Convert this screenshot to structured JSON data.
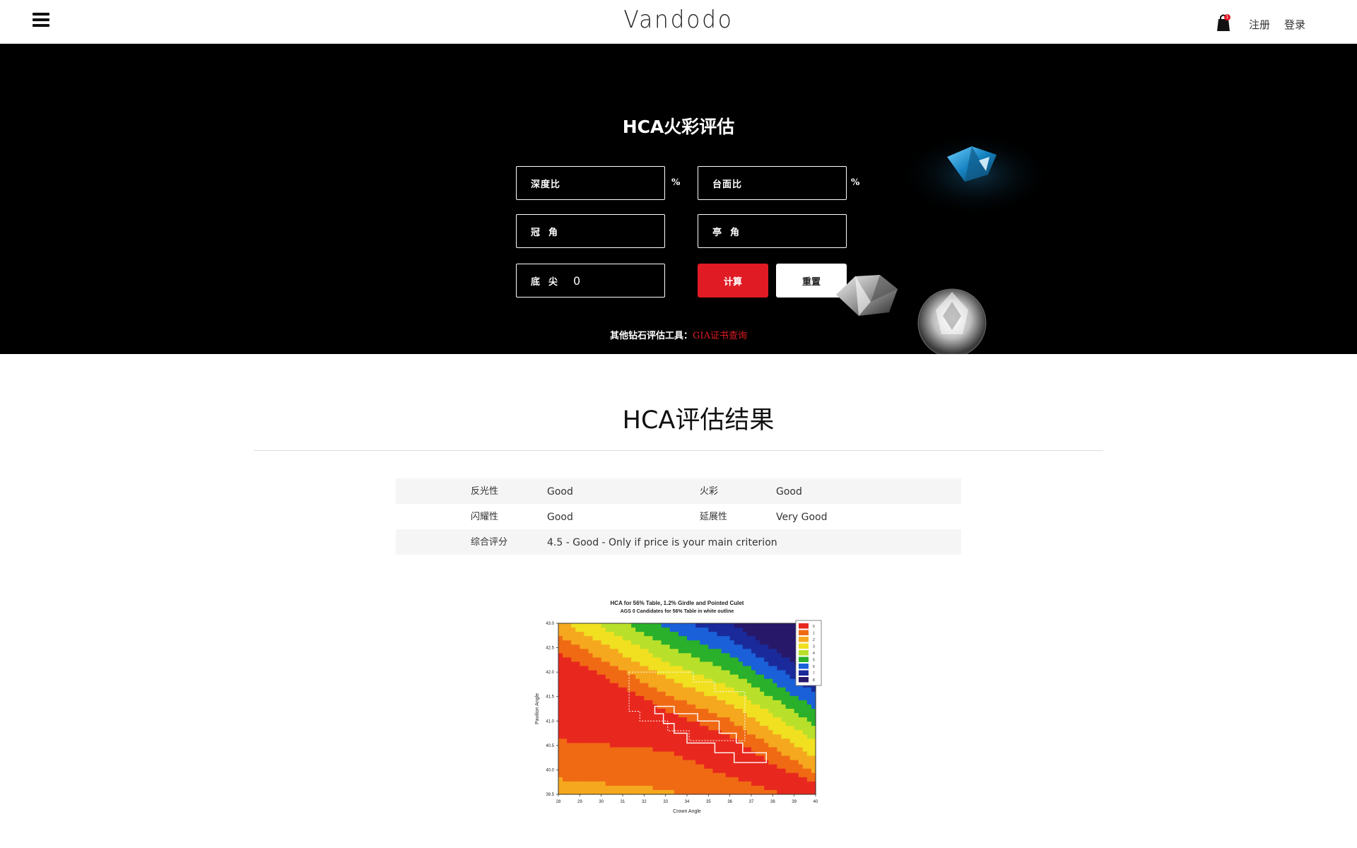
{
  "header": {
    "logo": "Vandodo",
    "cart_count": "1",
    "register": "注册",
    "login": "登录"
  },
  "hero": {
    "title": "HCA火彩评估",
    "fields": {
      "depth_ratio": {
        "label": "深度比",
        "unit": "%",
        "value": ""
      },
      "table_ratio": {
        "label": "台面比",
        "unit": "%",
        "value": ""
      },
      "crown_angle": {
        "label": "冠角",
        "value": ""
      },
      "pavilion_angle": {
        "label": "亭角",
        "value": ""
      },
      "culet": {
        "label": "底尖",
        "value": "0"
      }
    },
    "calculate_label": "计算",
    "reset_label": "重置",
    "other_tools_prefix": "其他钻石评估工具：",
    "gia_link": "GIA证书查询"
  },
  "results": {
    "title": "HCA评估结果",
    "rows": [
      {
        "label1": "反光性",
        "value1": "Good",
        "label2": "火彩",
        "value2": "Good"
      },
      {
        "label1": "闪耀性",
        "value1": "Good",
        "label2": "延展性",
        "value2": "Very Good"
      },
      {
        "label1": "综合评分",
        "value1": "4.5 - Good - Only if price is your main criterion"
      }
    ]
  },
  "chart_data": {
    "type": "heatmap",
    "title": "HCA for 56% Table, 1.2% Girdle and Pointed Culet",
    "subtitle": "AGS 0 Candidates for 56% Table in white outline",
    "xlabel": "Crown Angle",
    "ylabel": "Pavilion Angle",
    "xticks": [
      "28",
      "29",
      "30",
      "31",
      "32",
      "33",
      "34",
      "35",
      "36",
      "37",
      "38",
      "39",
      "40"
    ],
    "yticks": [
      "43.0",
      "42.5",
      "42.0",
      "41.5",
      "41.0",
      "40.5",
      "40.0",
      "39.5"
    ],
    "xlim": [
      28,
      40
    ],
    "ylim": [
      39.5,
      43.0
    ],
    "legend": [
      "0",
      "1",
      "2",
      "3",
      "4",
      "5",
      "6",
      "7",
      "8"
    ],
    "legend_colors": [
      "#e8281e",
      "#f06a14",
      "#f5a81e",
      "#f0e020",
      "#b8e02a",
      "#2ab02a",
      "#1a60d8",
      "#1a2a9a",
      "#28186a"
    ],
    "legend_position": "top-right"
  }
}
